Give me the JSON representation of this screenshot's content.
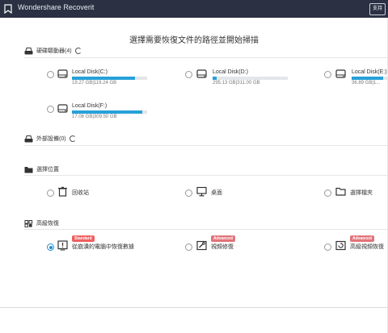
{
  "app": {
    "title": "Wondershare Recoverit",
    "support_label": "支持"
  },
  "page": {
    "title": "選擇需要恢復文件的路徑並開始掃描"
  },
  "sections": {
    "hard_drives": {
      "label": "硬碟驅動器(4)"
    },
    "external": {
      "label": "外部設備(0)"
    },
    "location": {
      "label": "選擇位置"
    },
    "advanced": {
      "label": "高級恢復"
    }
  },
  "disks": [
    {
      "name": "Local Disk(C:)",
      "size_text": "19.27 GB|119.24 GB",
      "used_fraction": 0.84
    },
    {
      "name": "Local Disk(D:)",
      "size_text": "295.13 GB|311.00 GB",
      "used_fraction": 0.05
    },
    {
      "name": "Local Disk(E:)",
      "size_text": "36.89 GB|1...",
      "used_fraction": 0.88
    },
    {
      "name": "Local Disk(F:)",
      "size_text": "17.06 GB|309.50 GB",
      "used_fraction": 0.94
    }
  ],
  "locations": [
    {
      "label": "回收站",
      "icon": "trash-icon"
    },
    {
      "label": "桌面",
      "icon": "desktop-icon"
    },
    {
      "label": "選擇檔夾",
      "icon": "folder-icon"
    }
  ],
  "advanced_options": [
    {
      "label": "從崩潰的電腦中恢復數據",
      "badge": "Standard",
      "icon": "crash-pc-icon",
      "selected": true
    },
    {
      "label": "視頻修復",
      "badge": "Advanced",
      "icon": "video-repair-icon",
      "selected": false
    },
    {
      "label": "高級視頻恢復",
      "badge": "Advanced",
      "icon": "video-recovery-icon",
      "selected": false
    }
  ],
  "colors": {
    "titlebar": "#2b3142",
    "accent": "#27a1d9",
    "badge": "#ef5f5f"
  }
}
